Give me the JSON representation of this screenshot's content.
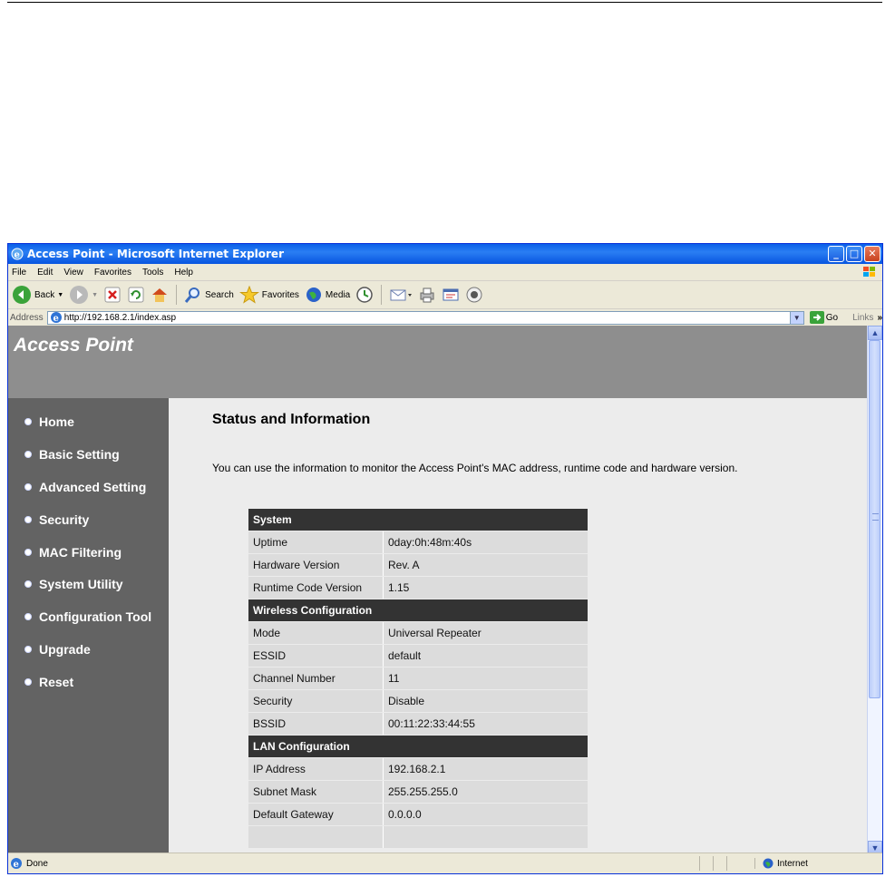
{
  "window": {
    "title": "Access Point - Microsoft Internet Explorer",
    "controls": [
      "_",
      "□",
      "✕"
    ]
  },
  "menu": [
    "File",
    "Edit",
    "View",
    "Favorites",
    "Tools",
    "Help"
  ],
  "toolbar": {
    "back": "Back",
    "search": "Search",
    "favorites": "Favorites",
    "media": "Media"
  },
  "address": {
    "label": "Address",
    "url": "http://192.168.2.1/index.asp",
    "go": "Go",
    "links": "Links"
  },
  "page": {
    "brand": "Access Point",
    "nav": [
      "Home",
      "Basic Setting",
      "Advanced Setting",
      "Security",
      "MAC Filtering",
      "System Utility",
      "Configuration Tool",
      "Upgrade",
      "Reset"
    ],
    "heading": "Status and Information",
    "description": "You can use the information to monitor the Access Point's MAC address, runtime code and hardware version.",
    "sections": [
      {
        "title": "System",
        "rows": [
          {
            "label": "Uptime",
            "value": "0day:0h:48m:40s"
          },
          {
            "label": "Hardware Version",
            "value": "Rev. A"
          },
          {
            "label": "Runtime Code Version",
            "value": "1.15"
          }
        ]
      },
      {
        "title": "Wireless Configuration",
        "rows": [
          {
            "label": "Mode",
            "value": "Universal Repeater"
          },
          {
            "label": "ESSID",
            "value": "default"
          },
          {
            "label": "Channel Number",
            "value": "11"
          },
          {
            "label": "Security",
            "value": "Disable"
          },
          {
            "label": "BSSID",
            "value": "00:11:22:33:44:55"
          }
        ]
      },
      {
        "title": "LAN Configuration",
        "rows": [
          {
            "label": "IP Address",
            "value": "192.168.2.1"
          },
          {
            "label": "Subnet Mask",
            "value": "255.255.255.0"
          },
          {
            "label": "Default Gateway",
            "value": "0.0.0.0"
          }
        ]
      }
    ]
  },
  "status": {
    "text": "Done",
    "zone": "Internet"
  }
}
